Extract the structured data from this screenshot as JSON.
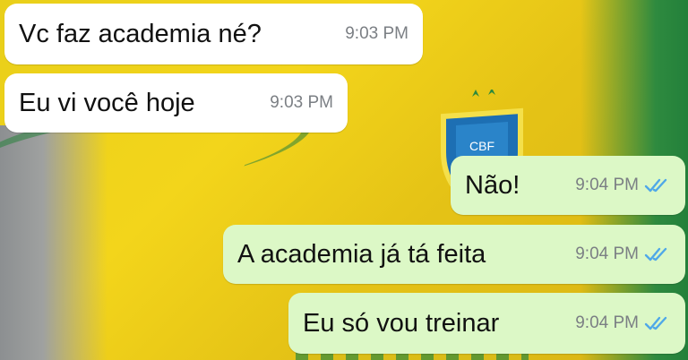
{
  "messages": [
    {
      "text": "Vc faz academia né?",
      "time": "9:03 PM",
      "direction": "incoming"
    },
    {
      "text": "Eu vi você hoje",
      "time": "9:03 PM",
      "direction": "incoming"
    },
    {
      "text": "Não!",
      "time": "9:04 PM",
      "direction": "outgoing",
      "status": "read"
    },
    {
      "text": "A academia já tá feita",
      "time": "9:04 PM",
      "direction": "outgoing",
      "status": "read"
    },
    {
      "text": "Eu só vou treinar",
      "time": "9:04 PM",
      "direction": "outgoing",
      "status": "read"
    }
  ],
  "background": {
    "crest_text": "CBF"
  },
  "colors": {
    "incoming_bubble": "#ffffff",
    "outgoing_bubble": "#dcf8c6",
    "read_check": "#4fa8e8",
    "timestamp": "#7b7f84",
    "shirt_yellow": "#f0d21a",
    "shirt_green": "#2d8a3c"
  },
  "icons": {
    "read_status": "double-check-icon"
  }
}
